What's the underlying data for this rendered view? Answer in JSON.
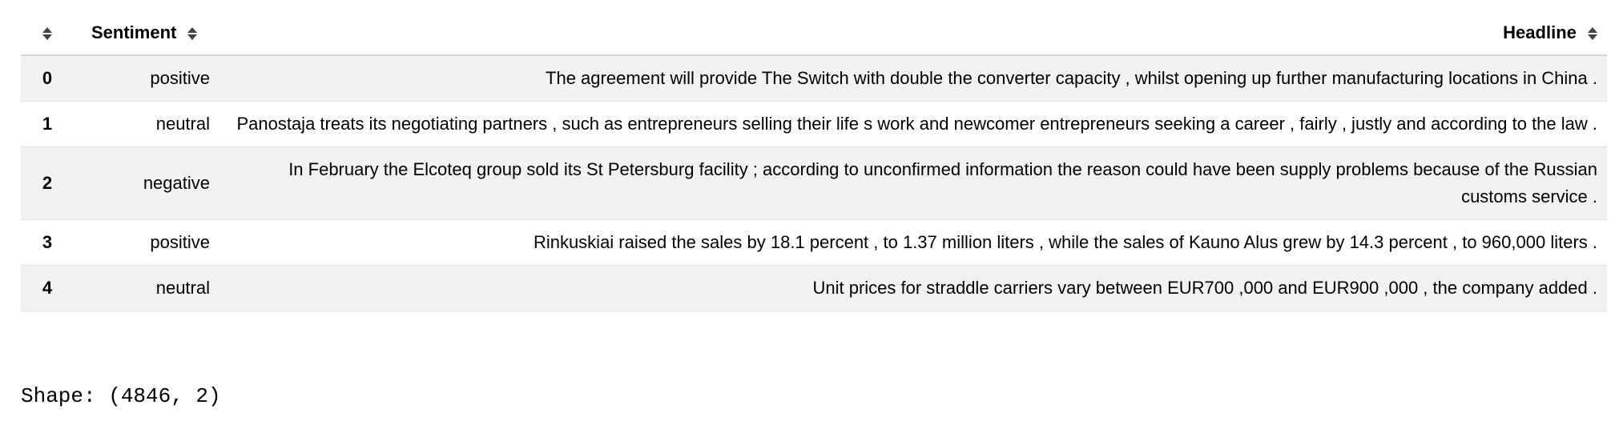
{
  "table": {
    "columns": {
      "index_header": "",
      "sentiment_header": "Sentiment",
      "headline_header": "Headline"
    },
    "rows": [
      {
        "index": "0",
        "sentiment": "positive",
        "headline": "The agreement will provide The Switch with double the converter capacity , whilst opening up further manufacturing locations in China ."
      },
      {
        "index": "1",
        "sentiment": "neutral",
        "headline": "Panostaja treats its negotiating partners , such as entrepreneurs selling their life s work and newcomer entrepreneurs seeking a career , fairly , justly and according to the law ."
      },
      {
        "index": "2",
        "sentiment": "negative",
        "headline": "In February the Elcoteq group sold its St Petersburg facility ; according to unconfirmed information the reason could have been supply problems because of the Russian customs service ."
      },
      {
        "index": "3",
        "sentiment": "positive",
        "headline": "Rinkuskiai raised the sales by 18.1 percent , to 1.37 million liters , while the sales of Kauno Alus grew by 14.3 percent , to 960,000 liters ."
      },
      {
        "index": "4",
        "sentiment": "neutral",
        "headline": "Unit prices for straddle carriers vary between EUR700 ,000 and EUR900 ,000 , the company added ."
      }
    ]
  },
  "output": {
    "shape_text": "Shape: (4846, 2)"
  },
  "icons": {
    "sort": "sort-icon"
  }
}
